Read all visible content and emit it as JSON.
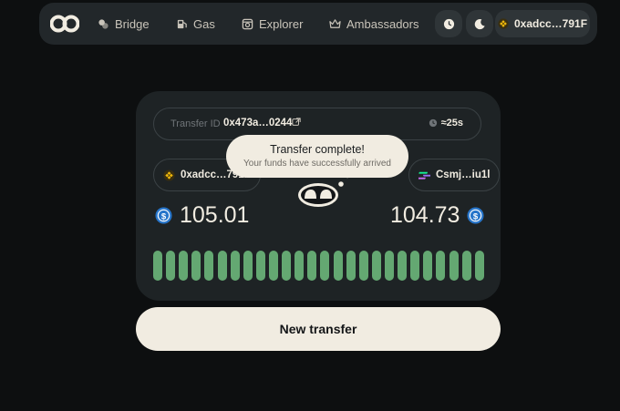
{
  "nav": {
    "items": [
      {
        "label": "Bridge",
        "icon": "bridge-icon"
      },
      {
        "label": "Gas",
        "icon": "gas-pump-icon"
      },
      {
        "label": "Explorer",
        "icon": "explorer-icon"
      },
      {
        "label": "Ambassadors",
        "icon": "crown-icon"
      }
    ],
    "history_icon": "clock-icon",
    "theme_icon": "moon-icon",
    "wallet_label": "0xadcc…791F"
  },
  "transfer": {
    "id_label": "Transfer ID",
    "id_value": "0x473a…0244",
    "eta": "≈25s",
    "source_address": "0xadcc…791F",
    "dest_address": "Csmj…iu1l",
    "sent_amount": "105.01",
    "received_amount": "104.73",
    "progress": 1.0
  },
  "toast": {
    "title": "Transfer complete!",
    "subtitle": "Your funds have successfully arrived"
  },
  "new_transfer_label": "New transfer",
  "colors": {
    "background": "#0d0f10",
    "panel": "#22272a",
    "card": "#1e2325",
    "cream": "#f1ece1",
    "progress_green": "#64a872",
    "usdc_blue": "#2775ca",
    "bnb_gold": "#f0b90b"
  }
}
